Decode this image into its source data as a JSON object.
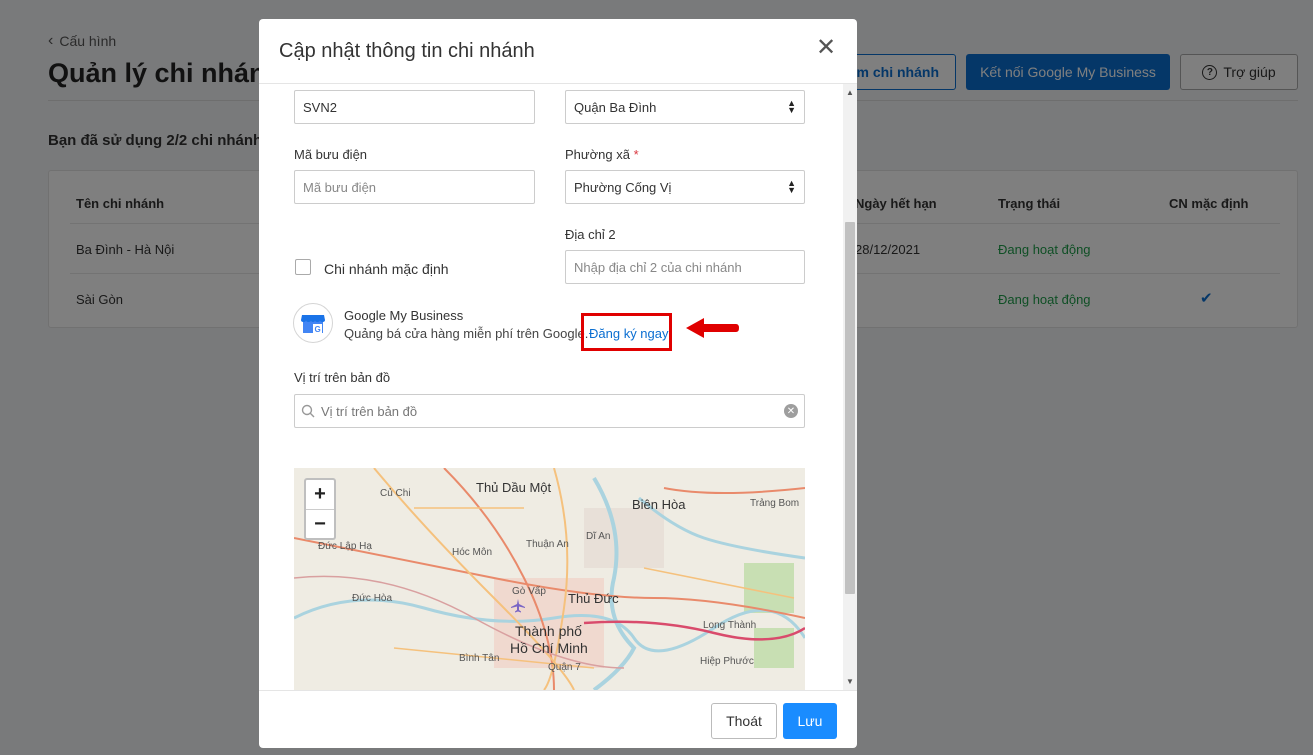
{
  "background": {
    "breadcrumb": "Cấu hình",
    "title": "Quản lý chi nhán",
    "buttons": {
      "add_branch": "êm chi nhánh",
      "connect_gmb": "Kết nối Google My Business",
      "help": "Trợ giúp"
    },
    "usage": "Bạn đã sử dụng 2/2 chi nhánh",
    "table": {
      "headers": {
        "name": "Tên chi nhánh",
        "expiry": "Ngày hết hạn",
        "status": "Trạng thái",
        "default": "CN mặc định"
      },
      "rows": [
        {
          "name": "Ba Đình - Hà Nội",
          "expiry": "28/12/2021",
          "status": "Đang hoạt động",
          "default": false
        },
        {
          "name": "Sài Gòn",
          "expiry": "",
          "status": "Đang hoạt động",
          "default": true
        }
      ]
    }
  },
  "modal": {
    "title": "Cập nhật thông tin chi nhánh",
    "close_symbol": "✕",
    "fields": {
      "code_value": "SVN2",
      "district_value": "Quận Ba Đình",
      "postal_label": "Mã bưu điện",
      "postal_placeholder": "Mã bưu điện",
      "ward_label": "Phường xã",
      "ward_required": "*",
      "ward_value": "Phường Cống Vị",
      "address2_label": "Địa chỉ 2",
      "address2_placeholder": "Nhập địa chỉ 2 của chi nhánh",
      "default_branch_label": "Chi nhánh mặc định"
    },
    "gmb": {
      "title": "Google My Business",
      "description": "Quảng bá cửa hàng miễn phí trên Google.",
      "link": "Đăng ký ngay"
    },
    "map_section": {
      "label": "Vị trí trên bản đồ",
      "search_placeholder": "Vị trí trên bản đồ",
      "zoom_in": "+",
      "zoom_out": "−",
      "places": [
        "Thủ Dầu Một",
        "Biên Hòa",
        "Củ Chi",
        "Trảng Bom",
        "Thuận An",
        "Dĩ An",
        "Hóc Môn",
        "Đức Lập Hạ",
        "Gò Vấp",
        "Thủ Đức",
        "Đức Hòa",
        "Long Thành",
        "Thành phố",
        "Hồ Chí Minh",
        "Bình Tân",
        "Quận 7",
        "Hiệp Phước"
      ]
    },
    "footer": {
      "exit": "Thoát",
      "save": "Lưu"
    }
  },
  "colors": {
    "primary": "#0a6ed1",
    "save_button": "#1a8cff",
    "active_status": "#1e9e4a",
    "highlight": "#e00000"
  }
}
